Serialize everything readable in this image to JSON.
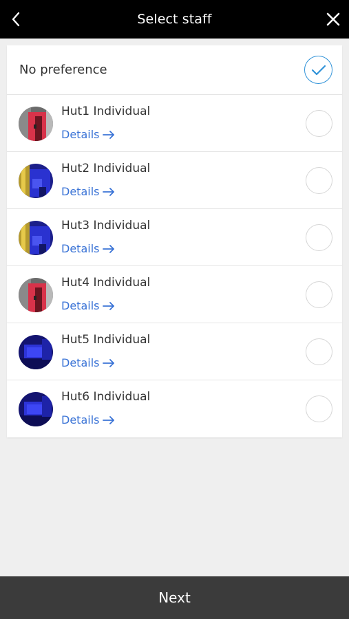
{
  "header": {
    "title": "Select staff",
    "back_icon": "chevron-left-icon",
    "close_icon": "close-icon"
  },
  "no_preference": {
    "label": "No preference",
    "selected": true,
    "icon": "checkmark-icon"
  },
  "staff": [
    {
      "name": "Hut1 Individual",
      "details_label": "Details",
      "avatar_theme": "red",
      "selected": false
    },
    {
      "name": "Hut2 Individual",
      "details_label": "Details",
      "avatar_theme": "blue-yellow",
      "selected": false
    },
    {
      "name": "Hut3 Individual",
      "details_label": "Details",
      "avatar_theme": "blue-yellow",
      "selected": false
    },
    {
      "name": "Hut4 Individual",
      "details_label": "Details",
      "avatar_theme": "red",
      "selected": false
    },
    {
      "name": "Hut5 Individual",
      "details_label": "Details",
      "avatar_theme": "blue",
      "selected": false
    },
    {
      "name": "Hut6 Individual",
      "details_label": "Details",
      "avatar_theme": "blue",
      "selected": false
    }
  ],
  "footer": {
    "next_label": "Next"
  },
  "colors": {
    "header_bg": "#000000",
    "footer_bg": "#3b3b3b",
    "accent": "#2f92d8",
    "link": "#3a73d6",
    "page_bg": "#efefef"
  }
}
